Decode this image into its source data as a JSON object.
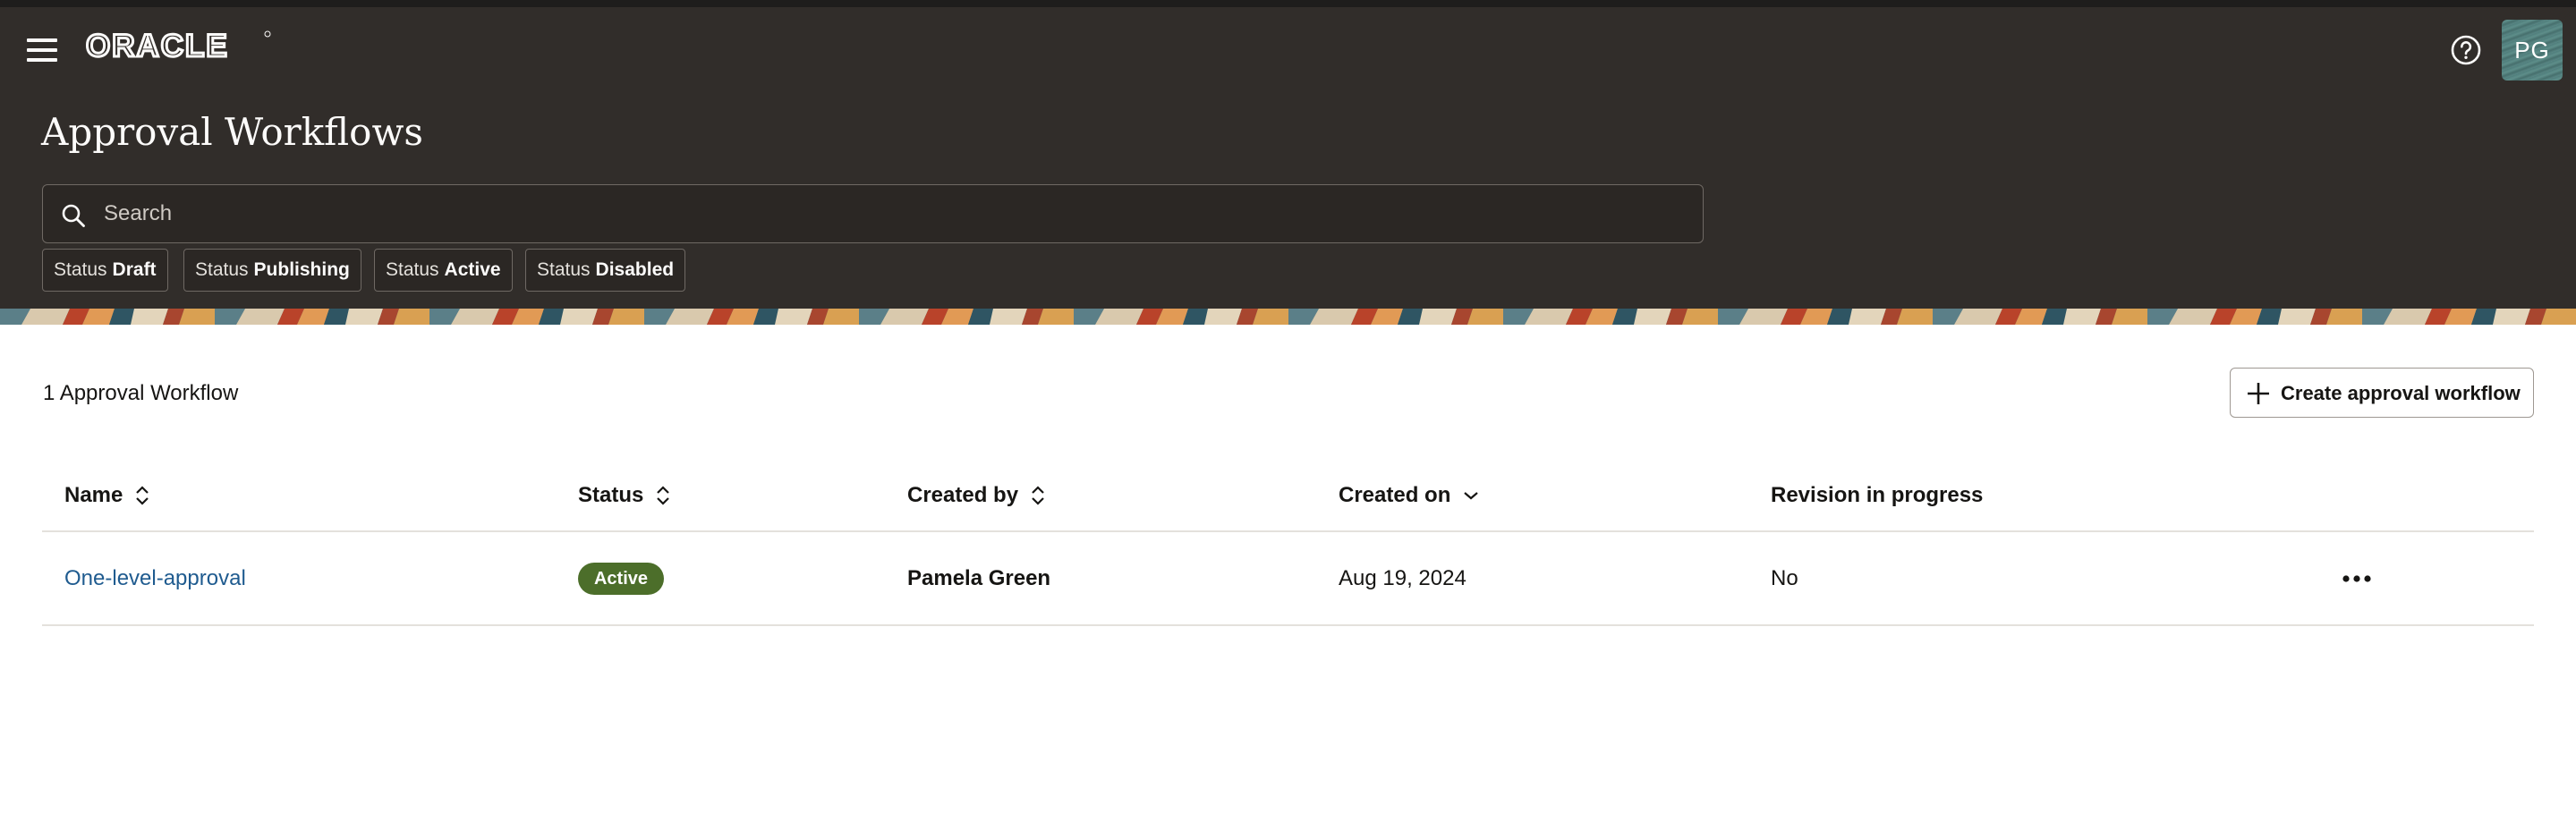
{
  "header": {
    "logo_text": "ORACLE",
    "page_title": "Approval Workflows",
    "avatar_initials": "PG",
    "menu_icon": "hamburger-menu-icon",
    "help_icon": "help-circle-icon"
  },
  "search": {
    "placeholder": "Search",
    "value": ""
  },
  "filters": [
    {
      "key": "Status",
      "value": "Draft"
    },
    {
      "key": "Status",
      "value": "Publishing"
    },
    {
      "key": "Status",
      "value": "Active"
    },
    {
      "key": "Status",
      "value": "Disabled"
    }
  ],
  "results": {
    "count_label": "1 Approval Workflow",
    "create_label": "Create approval workflow"
  },
  "table": {
    "columns": [
      {
        "label": "Name",
        "sort": "sortable"
      },
      {
        "label": "Status",
        "sort": "sortable"
      },
      {
        "label": "Created by",
        "sort": "sortable"
      },
      {
        "label": "Created on",
        "sort": "descending"
      },
      {
        "label": "Revision in progress",
        "sort": "none"
      }
    ],
    "rows": [
      {
        "name": "One-level-approval",
        "status": "Active",
        "created_by": "Pamela Green",
        "created_on": "Aug 19, 2024",
        "revision_in_progress": "No"
      }
    ]
  },
  "colors": {
    "header_bg": "#312d2a",
    "link": "#1f5b8f",
    "active_badge": "#4c6e2a"
  }
}
